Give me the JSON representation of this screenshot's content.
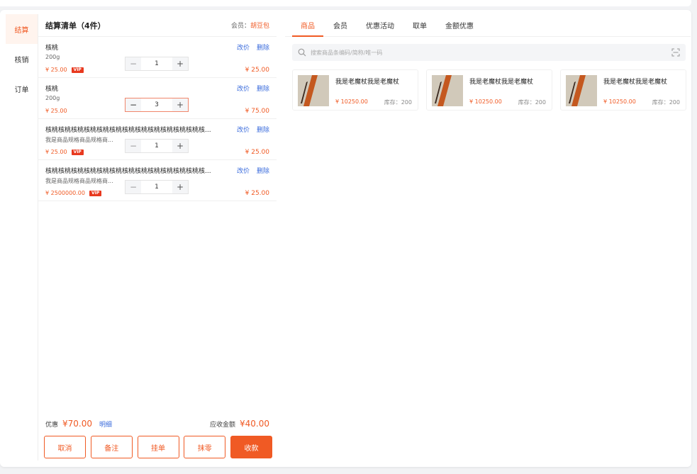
{
  "nav": {
    "items": [
      {
        "label": "结算",
        "active": true
      },
      {
        "label": "核销",
        "active": false
      },
      {
        "label": "订单",
        "active": false
      }
    ]
  },
  "cart": {
    "title": "结算清单（4件）",
    "member_label": "会员：",
    "member_name": "胡豆包",
    "edit_price_label": "改价",
    "delete_label": "删除",
    "items": [
      {
        "name": "核桃",
        "spec": "200g",
        "price": "¥ 25.00",
        "vip": false,
        "qty": "1",
        "total": "¥ 25.00"
      },
      {
        "name": "核桃",
        "spec": "200g",
        "price": "¥ 25.00",
        "vip": false,
        "qty": "3",
        "total": "¥ 75.00"
      },
      {
        "name": "核桃核桃核桃核桃核桃核桃核桃核桃核桃核桃核桃核桃核...",
        "spec": "我是商品规格商品规格商...",
        "price": "¥ 25.00",
        "vip": true,
        "qty": "1",
        "total": "¥ 25.00"
      },
      {
        "name": "核桃核桃核桃核桃核桃核桃核桃核桃核桃核桃核桃核桃核...",
        "spec": "我是商品规格商品规格商...",
        "price": "¥ 2500000.00",
        "vip": true,
        "qty": "1",
        "total": "¥ 25.00"
      }
    ],
    "vip_badge": "VIP",
    "summary": {
      "discount_label": "优惠",
      "discount_amount": "¥70.00",
      "detail_link": "明细",
      "due_label": "应收金额",
      "due_amount": "¥40.00"
    },
    "buttons": {
      "cancel": "取消",
      "note": "备注",
      "hold": "挂单",
      "round_off": "抹零",
      "checkout": "收款"
    }
  },
  "products": {
    "tabs": [
      {
        "label": "商品",
        "active": true
      },
      {
        "label": "会员",
        "active": false
      },
      {
        "label": "优惠活动",
        "active": false
      },
      {
        "label": "取单",
        "active": false
      },
      {
        "label": "金额优惠",
        "active": false
      }
    ],
    "search": {
      "placeholder": "搜索商品条编码/简称/唯一码",
      "value": ""
    },
    "cards": [
      {
        "name": "我是老魔杖我是老魔杖",
        "price": "¥ 10250.00",
        "stock": "库存：200"
      },
      {
        "name": "我是老魔杖我是老魔杖",
        "price": "¥ 10250.00",
        "stock": "库存：200"
      },
      {
        "name": "我是老魔杖我是老魔杖",
        "price": "¥ 10250.00",
        "stock": "库存：200"
      }
    ]
  },
  "colors": {
    "accent": "#f05a24",
    "link": "#3a6bdc",
    "vip": "#e8391f"
  },
  "icons": {
    "search": "search-icon",
    "scan": "scan-icon"
  }
}
